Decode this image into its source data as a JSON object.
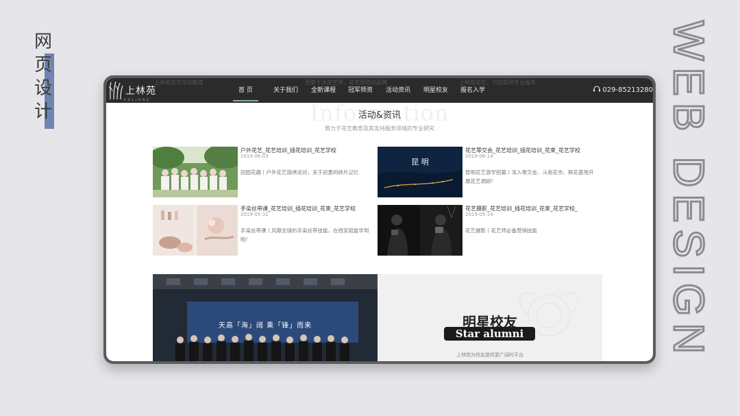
{
  "side_label": {
    "chars": [
      "网",
      "页",
      "设",
      "计"
    ]
  },
  "big_vertical_text": "WEB DESIGN",
  "nav": {
    "logo_text": "上林苑",
    "logo_sub": "SOLIONS",
    "ghost_texts": [
      "上林苑花艺培训教育",
      "西安十大花艺师，花艺师培训品牌",
      "上林苑花艺，为您提供专业服务"
    ],
    "items": [
      "首 页",
      "关于我们",
      "全新课程",
      "冠军师资",
      "活动资讯",
      "明星校友",
      "报名入学"
    ],
    "phone": "029-85213280"
  },
  "section": {
    "watermark": "Information",
    "title": "活动&资讯",
    "subtitle": "致力于花艺教育及其支持服务领域的专业研究"
  },
  "news": [
    {
      "title": "户外花艺_花艺培训_插花培训_花艺学校",
      "date": "2019-06-03",
      "desc": "田园花趣丨户外花艺烧烤派对，关于初夏的碎片记忆"
    },
    {
      "title": "花艺零交会_花艺培训_插花培训_花束_花艺学校",
      "date": "2019-06-14",
      "desc": "昆明花艺游学招募丨深入零交会、斗南花市、鲜花基地开展花艺调研!",
      "thumb_text": "昆 明"
    },
    {
      "title": "手染丝带课_花艺培训_插花培训_花束_花艺学校",
      "date": "2019-05-31",
      "desc": "手染丝带课丨风靡全球的手染丝带技能，在西安就能学到啦!"
    },
    {
      "title": "花艺摄影_花艺培训_插花培训_花束_花艺学校_",
      "date": "2019-05-14",
      "desc": "花艺摄影丨花艺师必备营销技能"
    }
  ],
  "banner": {
    "stage_text": "天高「海」阔  乘「锋」而来",
    "alumni_cn": "明星校友",
    "alumni_en": "Star alumni",
    "alumni_sub": "上林苑为校友提供更广阔的平台"
  }
}
